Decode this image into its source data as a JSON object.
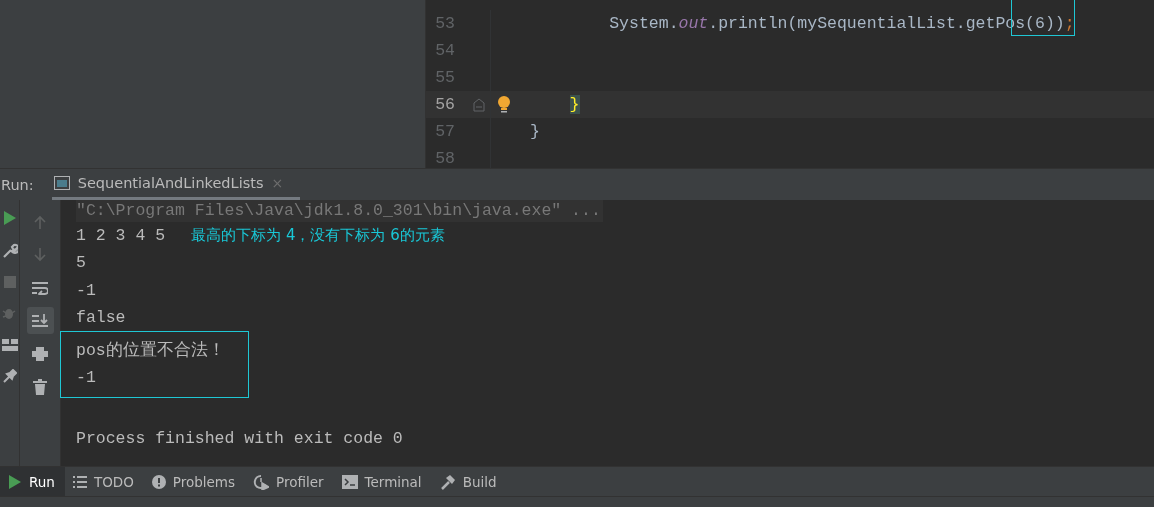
{
  "editor": {
    "lines": [
      {
        "number": "53",
        "current": false,
        "tokens": [
          {
            "text": "        System.",
            "kind": "plain"
          },
          {
            "text": "out",
            "kind": "field"
          },
          {
            "text": ".println(mySequentialList.getPo",
            "kind": "plain"
          },
          {
            "text": "s(6))",
            "kind": "plain",
            "marked": true
          },
          {
            "text": ";",
            "kind": "keyword"
          }
        ]
      },
      {
        "number": "54",
        "current": false
      },
      {
        "number": "55",
        "current": false
      },
      {
        "number": "56",
        "current": true,
        "gutter": [
          {
            "kind": "fold"
          },
          {
            "kind": "bulb"
          }
        ],
        "tokens": [
          {
            "text": "    }",
            "kind": "brace-match"
          }
        ]
      },
      {
        "number": "57",
        "current": false,
        "tokens": [
          {
            "text": "}",
            "kind": "plain"
          }
        ]
      },
      {
        "number": "58",
        "current": false
      }
    ]
  },
  "run_panel": {
    "label": "Run:",
    "tab": {
      "title": "SequentialAndLinkedLists",
      "close": "×",
      "selected": true
    },
    "left_toolbar": [
      {
        "kind": "run"
      },
      {
        "kind": "wrench"
      },
      {
        "kind": "stop"
      },
      {
        "kind": "bug"
      },
      {
        "kind": "layout"
      },
      {
        "kind": "pin"
      }
    ],
    "console_toolbar": [
      {
        "kind": "up",
        "on": false
      },
      {
        "kind": "down",
        "on": false
      },
      {
        "kind": "wrap",
        "on": false
      },
      {
        "kind": "scroll-end",
        "on": true
      },
      {
        "kind": "print",
        "on": false
      },
      {
        "kind": "trash",
        "on": false
      }
    ],
    "console": [
      {
        "kind": "command",
        "text": "\"C:\\Program Files\\Java\\jdk1.8.0_301\\bin\\java.exe\" ..."
      },
      {
        "kind": "output",
        "text": "1 2 3 4 5",
        "note": "最高的下标为 4，没有下标为 6的元素"
      },
      {
        "kind": "output",
        "text": "5"
      },
      {
        "kind": "output",
        "text": "-1"
      },
      {
        "kind": "output",
        "text": "false"
      },
      {
        "kind": "output",
        "text": "pos的位置不合法！",
        "boxed": true
      },
      {
        "kind": "output",
        "text": "-1",
        "boxed": true
      },
      {
        "kind": "blank"
      },
      {
        "kind": "output",
        "text": "Process finished with exit code 0"
      }
    ]
  },
  "tool_windows": [
    {
      "kind": "run",
      "label": "Run",
      "selected": true
    },
    {
      "kind": "list",
      "label": "TODO",
      "selected": false
    },
    {
      "kind": "problems",
      "label": "Problems",
      "selected": false
    },
    {
      "kind": "profiler",
      "label": "Profiler",
      "selected": false
    },
    {
      "kind": "terminal",
      "label": "Terminal",
      "selected": false
    },
    {
      "kind": "hammer",
      "label": "Build",
      "selected": false
    }
  ]
}
